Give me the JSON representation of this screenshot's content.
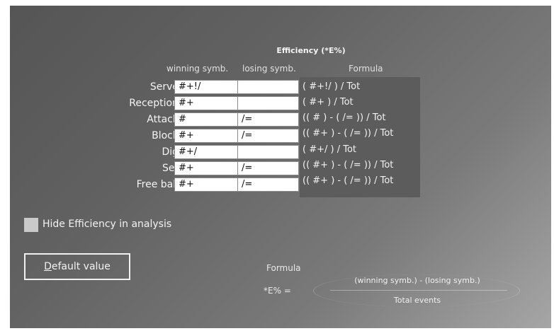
{
  "title": "Efficiency (*E%)",
  "headers": {
    "winning": "winning symb.",
    "losing": "losing symb.",
    "formula": "Formula"
  },
  "rows": [
    {
      "label": "Serve",
      "winning": "#+!/",
      "losing": "",
      "formula": "( #+!/ ) / Tot"
    },
    {
      "label": "Reception",
      "winning": "#+",
      "losing": "",
      "formula": "( #+ ) / Tot"
    },
    {
      "label": "Attack",
      "winning": "#",
      "losing": "/=",
      "formula": "(( # ) - ( /= )) / Tot"
    },
    {
      "label": "Block",
      "winning": "#+",
      "losing": "/=",
      "formula": "(( #+ ) - ( /= )) / Tot"
    },
    {
      "label": "Dig",
      "winning": "#+/",
      "losing": "",
      "formula": "( #+/ ) / Tot"
    },
    {
      "label": "Set",
      "winning": "#+",
      "losing": "/=",
      "formula": "(( #+ ) - ( /= )) / Tot"
    },
    {
      "label": "Free ball",
      "winning": "#+",
      "losing": "/=",
      "formula": "(( #+ ) - ( /= )) / Tot"
    }
  ],
  "hide_efficiency": {
    "label": "Hide Efficiency in analysis",
    "checked": false
  },
  "default_button": {
    "accel": "D",
    "rest": "efault value"
  },
  "formula_section": {
    "title": "Formula",
    "lhs": "*E% =",
    "numerator": "(winning symb.) - (losing symb.)",
    "denominator": "Total events"
  }
}
